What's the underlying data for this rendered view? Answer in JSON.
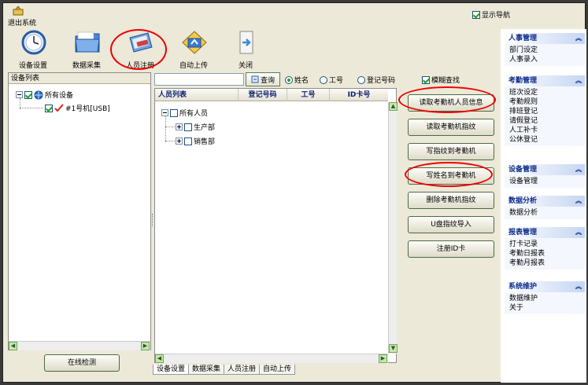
{
  "topbar": {
    "exit_label": "退出系统",
    "show_nav_label": "显示导航",
    "show_nav_checked": true
  },
  "toolbar": {
    "items": [
      {
        "label": "设备设置",
        "icon": "clock-icon"
      },
      {
        "label": "数据采集",
        "icon": "folder-icon"
      },
      {
        "label": "人员注册",
        "icon": "id-card-icon"
      },
      {
        "label": "自动上传",
        "icon": "upload-icon"
      },
      {
        "label": "关闭",
        "icon": "exit-door-icon"
      }
    ]
  },
  "devices": {
    "title": "设备列表",
    "root": "所有设备",
    "device": "#1号机[USB]",
    "online_button": "在线检测"
  },
  "search": {
    "value": "",
    "query_label": "查询",
    "radios": [
      "姓名",
      "工号",
      "登记号码"
    ],
    "selected_radio": 0,
    "fuzzy_label": "模糊查找",
    "fuzzy_checked": true
  },
  "personnel": {
    "headers": [
      "人员列表",
      "登记号码",
      "工号",
      "ID卡号"
    ],
    "root": "所有人员",
    "departments": [
      "生产部",
      "销售部"
    ]
  },
  "actions": [
    "读取考勤机人员信息",
    "读取考勤机指纹",
    "写指纹到考勤机",
    "写姓名到考勤机",
    "删除考勤机指纹",
    "U盘指纹导入",
    "注册ID卡"
  ],
  "tabs": [
    "设备设置",
    "数据采集",
    "人员注册",
    "自动上传"
  ],
  "nav": [
    {
      "title": "人事管理",
      "items": [
        "部门设定",
        "人事录入"
      ]
    },
    {
      "title": "考勤管理",
      "items": [
        "班次设定",
        "考勤规则",
        "排班登记",
        "请假登记",
        "人工补卡",
        "公休登记"
      ]
    },
    {
      "title": "设备管理",
      "items": [
        "设备管理"
      ]
    },
    {
      "title": "数据分析",
      "items": [
        "数据分析"
      ]
    },
    {
      "title": "报表管理",
      "items": [
        "打卡记录",
        "考勤日报表",
        "考勤月报表"
      ]
    },
    {
      "title": "系统维护",
      "items": [
        "数据维护",
        "关于"
      ]
    }
  ],
  "colors": {
    "highlight_oval": "#e00000",
    "nav_title": "#0b2a8a",
    "check": "#21a121"
  }
}
